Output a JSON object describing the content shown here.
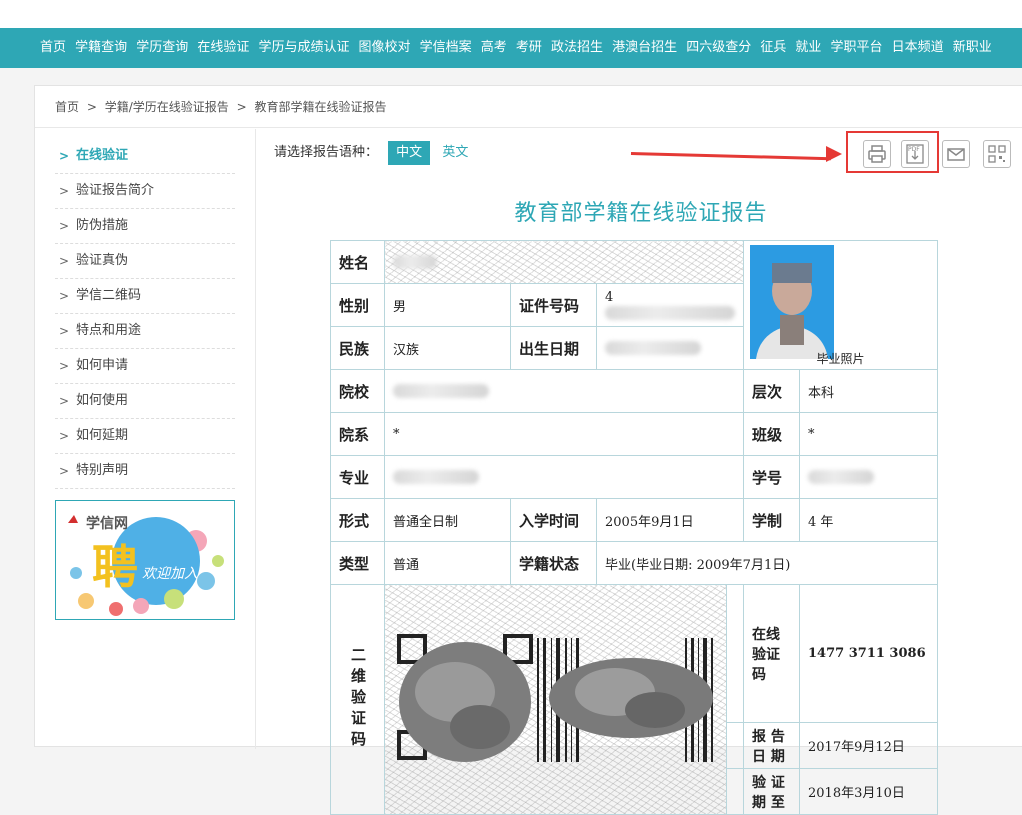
{
  "nav": {
    "items": [
      "首页",
      "学籍查询",
      "学历查询",
      "在线验证",
      "学历与成绩认证",
      "图像校对",
      "学信档案",
      "高考",
      "考研",
      "政法招生",
      "港澳台招生",
      "四六级查分",
      "征兵",
      "就业",
      "学职平台",
      "日本频道",
      "新职业"
    ]
  },
  "breadcrumb": [
    "首页",
    ">",
    "学籍/学历在线验证报告",
    ">",
    "教育部学籍在线验证报告"
  ],
  "sidebar": {
    "items": [
      {
        "label": "在线验证",
        "active": true
      },
      {
        "label": "验证报告简介"
      },
      {
        "label": "防伪措施"
      },
      {
        "label": "验证真伪"
      },
      {
        "label": "学信二维码"
      },
      {
        "label": "特点和用途"
      },
      {
        "label": "如何申请"
      },
      {
        "label": "如何使用"
      },
      {
        "label": "如何延期"
      },
      {
        "label": "特别声明"
      }
    ],
    "banner": {
      "brand": "学信网",
      "big": "聘",
      "slogan": "欢迎加入"
    }
  },
  "lang": {
    "label": "请选择报告语种：",
    "zh": "中文",
    "en": "英文"
  },
  "tools": {
    "print": "print-icon",
    "pdf_text": "PDF",
    "mail": "mail-icon",
    "qr": "qrcode-icon"
  },
  "report": {
    "title": "教育部学籍在线验证报告",
    "labels": {
      "name": "姓名",
      "gender": "性别",
      "id": "证件号码",
      "ethnic": "民族",
      "dob": "出生日期",
      "school": "院校",
      "level": "层次",
      "dept": "院系",
      "class": "班级",
      "major": "专业",
      "sid": "学号",
      "form": "形式",
      "enroll": "入学时间",
      "duration": "学制",
      "type": "类型",
      "status": "学籍状态",
      "qr": "二维验证码",
      "code": "在线验证码",
      "date": "报 告 日 期",
      "expire": "验 证 期 至",
      "photo": "毕业照片"
    },
    "values": {
      "gender": "男",
      "id_prefix": "4",
      "ethnic": "汉族",
      "level": "本科",
      "dept": "*",
      "class": "*",
      "form": "普通全日制",
      "enroll": "2005年9月1日",
      "duration": "4 年",
      "type": "普通",
      "status": "毕业(毕业日期: 2009年7月1日)",
      "code": "1477 3711 3086",
      "date": "2017年9月12日",
      "expire": "2018年3月10日"
    }
  }
}
